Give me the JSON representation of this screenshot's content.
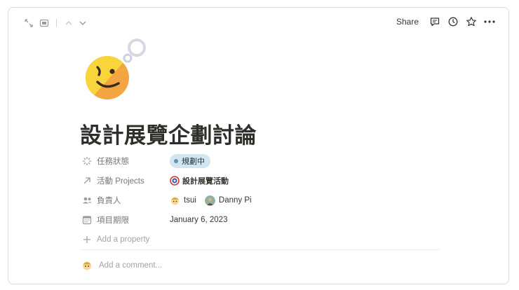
{
  "topbar": {
    "share_label": "Share",
    "left_icons": [
      "expand-icon",
      "peek-mode-icon",
      "chevron-up-icon",
      "chevron-down-icon"
    ],
    "right_icons": [
      "comment-icon",
      "clock-icon",
      "star-icon",
      "more-icon"
    ]
  },
  "page": {
    "icon": "smiley-balloon-icon",
    "title": "設計展覽企劃討論"
  },
  "properties": [
    {
      "icon": "status-icon",
      "label": "任務狀態"
    },
    {
      "icon": "arrow-up-right-icon",
      "label": "活動 Projects"
    },
    {
      "icon": "people-icon",
      "label": "負責人"
    },
    {
      "icon": "calendar-icon",
      "label": "項目期限"
    }
  ],
  "values": {
    "status": "規劃中",
    "project": "設計展覽活動",
    "people": [
      "tsui",
      "Danny Pi"
    ],
    "date": "January 6, 2023"
  },
  "add_property_label": "Add a property",
  "comment_placeholder": "Add a comment...",
  "colors": {
    "status_bg": "#d3e5ef",
    "status_dot": "#5b97bd",
    "text": "#37352f",
    "muted": "#787774",
    "placeholder": "#a4a3a0"
  }
}
